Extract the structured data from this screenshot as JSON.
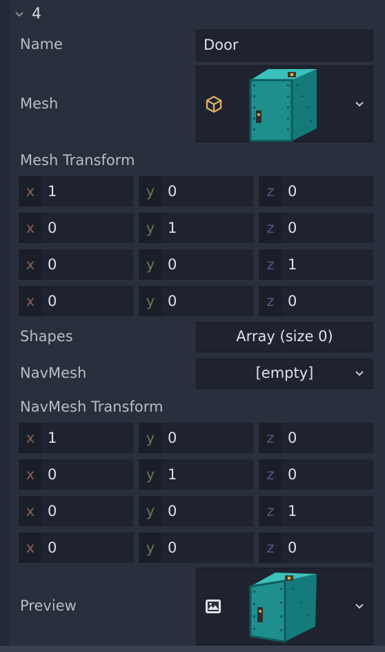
{
  "section": {
    "title": "4"
  },
  "name": {
    "label": "Name",
    "value": "Door"
  },
  "mesh": {
    "label": "Mesh"
  },
  "mesh_transform": {
    "label": "Mesh Transform",
    "rows": [
      [
        "1",
        "0",
        "0"
      ],
      [
        "0",
        "1",
        "0"
      ],
      [
        "0",
        "0",
        "1"
      ],
      [
        "0",
        "0",
        "0"
      ]
    ]
  },
  "shapes": {
    "label": "Shapes",
    "value": "Array (size 0)"
  },
  "navmesh": {
    "label": "NavMesh",
    "value": "[empty]"
  },
  "navmesh_transform": {
    "label": "NavMesh Transform",
    "rows": [
      [
        "1",
        "0",
        "0"
      ],
      [
        "0",
        "1",
        "0"
      ],
      [
        "0",
        "0",
        "1"
      ],
      [
        "0",
        "0",
        "0"
      ]
    ]
  },
  "preview": {
    "label": "Preview"
  },
  "axes": {
    "x": "x",
    "y": "y",
    "z": "z"
  },
  "icons": {
    "section_collapse": "chevron-down-icon",
    "mesh_type": "mesh-cube-icon",
    "preview_type": "image-icon",
    "dropdown": "chevron-down-icon"
  },
  "colors": {
    "background": "#232836",
    "panel": "#2a2f3d",
    "field": "#1f2330",
    "axis_x": "#8a6152",
    "axis_y": "#5f7f4f",
    "axis_z": "#5b5487",
    "mesh_icon": "#e0b060",
    "teal_asset": "#2aa7a4"
  }
}
